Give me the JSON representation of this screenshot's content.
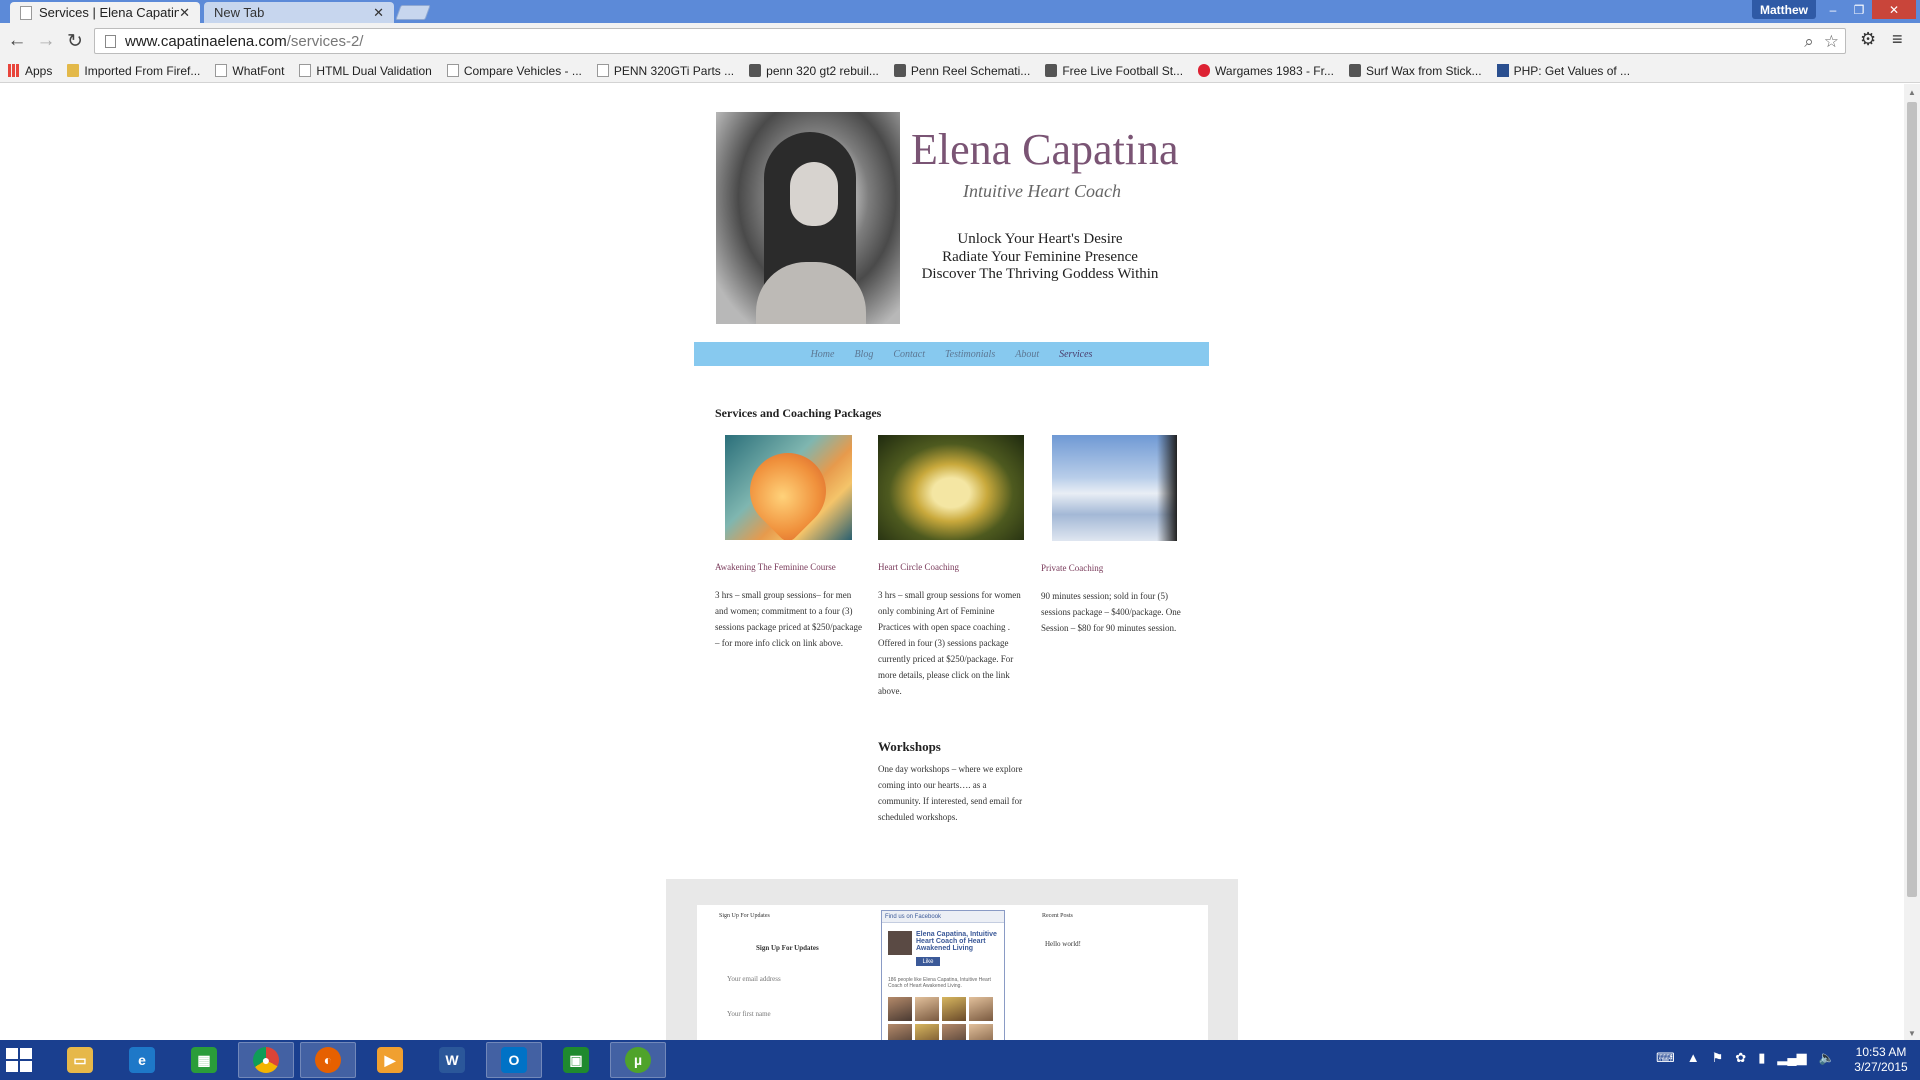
{
  "browser": {
    "tabs": [
      {
        "title": "Services | Elena Capatina",
        "close": "✕"
      },
      {
        "title": "New Tab",
        "close": "✕"
      }
    ],
    "profile_name": "Matthew",
    "window_controls": {
      "minimize": "–",
      "maximize": "❐",
      "close": "✕"
    },
    "url_host": "www.capatinaelena.com",
    "url_path": "/services-2/",
    "bookmarks": [
      {
        "label": "Apps",
        "icon": "apps-grid-icon"
      },
      {
        "label": "Imported From Firef...",
        "icon": "folder-icon"
      },
      {
        "label": "WhatFont",
        "icon": "page-icon"
      },
      {
        "label": "HTML Dual Validation",
        "icon": "page-icon"
      },
      {
        "label": "Compare Vehicles - ...",
        "icon": "page-icon"
      },
      {
        "label": "PENN 320GTi Parts ...",
        "icon": "page-icon"
      },
      {
        "label": "penn 320 gt2 rebuil...",
        "icon": "site-icon"
      },
      {
        "label": "Penn Reel Schemati...",
        "icon": "site-icon"
      },
      {
        "label": "Free Live Football St...",
        "icon": "site-icon"
      },
      {
        "label": "Wargames 1983 - Fr...",
        "icon": "red-site-icon"
      },
      {
        "label": "Surf Wax from Stick...",
        "icon": "site-icon"
      },
      {
        "label": "PHP: Get Values of ...",
        "icon": "fc-icon"
      }
    ]
  },
  "site": {
    "title": "Elena Capatina",
    "tagline": "Intuitive Heart Coach",
    "motto": [
      "Unlock Your Heart's Desire",
      "Radiate Your Feminine Presence",
      "Discover The Thriving Goddess Within"
    ],
    "nav": [
      "Home",
      "Blog",
      "Contact",
      "Testimonials",
      "About",
      "Services"
    ],
    "active_nav": "Services",
    "section_title": "Services and Coaching Packages",
    "services": [
      {
        "title": "Awakening The Feminine Course",
        "desc": "3 hrs – small group sessions– for men and women; commitment to a four (3) sessions package priced at $250/package – for more info click on link above."
      },
      {
        "title": "Heart Circle Coaching",
        "desc": "3 hrs – small group sessions for women only combining Art of Feminine Practices with open space coaching . Offered in four (3) sessions package currently priced at $250/package. For more details, please click on the link above."
      },
      {
        "title": "Private Coaching",
        "desc": "90 minutes session; sold in four (5) sessions package – $400/package. One Session – $80 for 90 minutes session."
      }
    ],
    "workshops": {
      "title": "Workshops",
      "desc": "One day workshops – where we explore coming into our hearts…. as a community. If interested, send email for scheduled workshops."
    },
    "footer": {
      "signup_widget_label": "Sign Up For Updates",
      "signup_heading": "Sign Up For Updates",
      "email_placeholder": "Your email address",
      "name_placeholder": "Your first name",
      "facebook": {
        "header": "Find us on Facebook",
        "page_name": "Elena Capatina, Intuitive Heart Coach of Heart Awakened Living",
        "like_label": "Like",
        "like_count": "186 people like Elena Capatina, Intuitive Heart Coach of Heart Awakened Living."
      },
      "recent_posts_label": "Recent Posts",
      "recent_posts": [
        "Hello world!"
      ]
    }
  },
  "taskbar": {
    "apps": [
      "file-explorer",
      "internet-explorer",
      "store",
      "chrome",
      "firefox",
      "media-player",
      "word",
      "outlook",
      "green-app",
      "utorrent"
    ],
    "time": "10:53 AM",
    "date": "3/27/2015"
  }
}
